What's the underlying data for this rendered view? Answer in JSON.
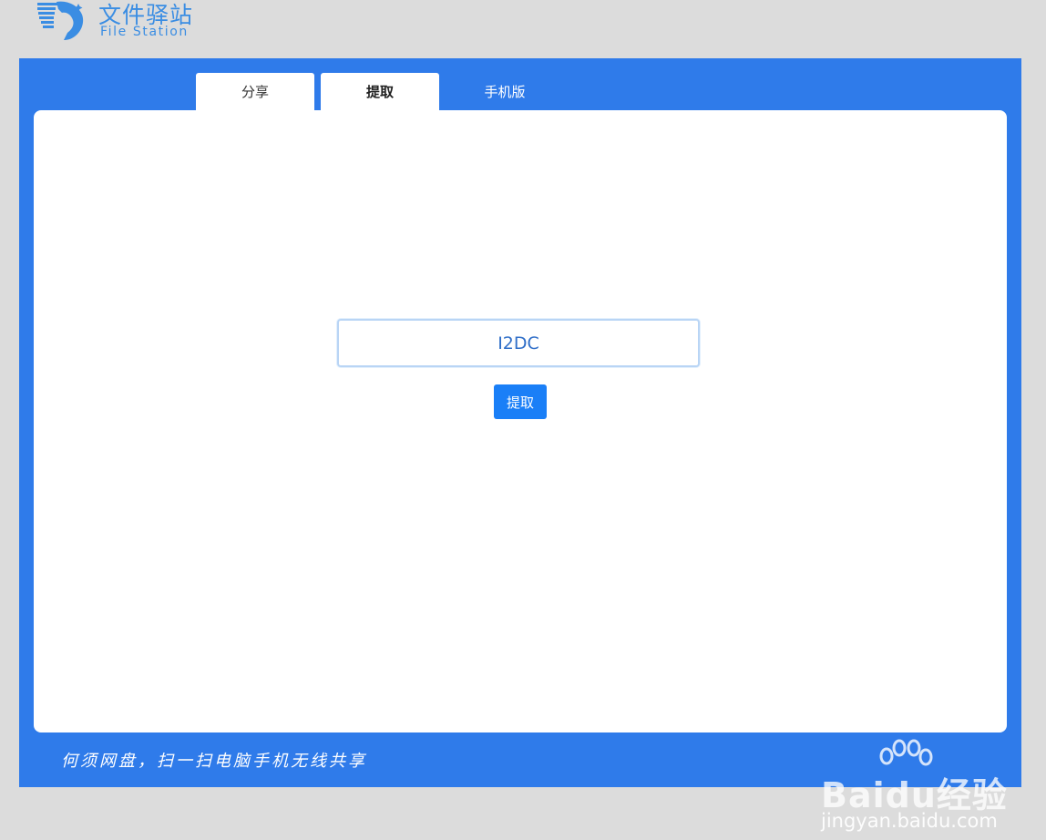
{
  "logo": {
    "name_cn": "文件驿站",
    "name_en": "File Station"
  },
  "tabs": [
    {
      "label": "分享"
    },
    {
      "label": "提取"
    },
    {
      "label": "手机版"
    }
  ],
  "extract": {
    "code_value": "I2DC",
    "button_label": "提取"
  },
  "footer": {
    "slogan": "何须网盘，扫一扫电脑手机无线共享"
  },
  "watermark": {
    "brand": "Baidu经验",
    "url": "jingyan.baidu.com"
  },
  "colors": {
    "frame": "#2f7bea",
    "button": "#1a7ff7",
    "logo": "#3a8de3",
    "page_bg": "#dcdcdc"
  }
}
